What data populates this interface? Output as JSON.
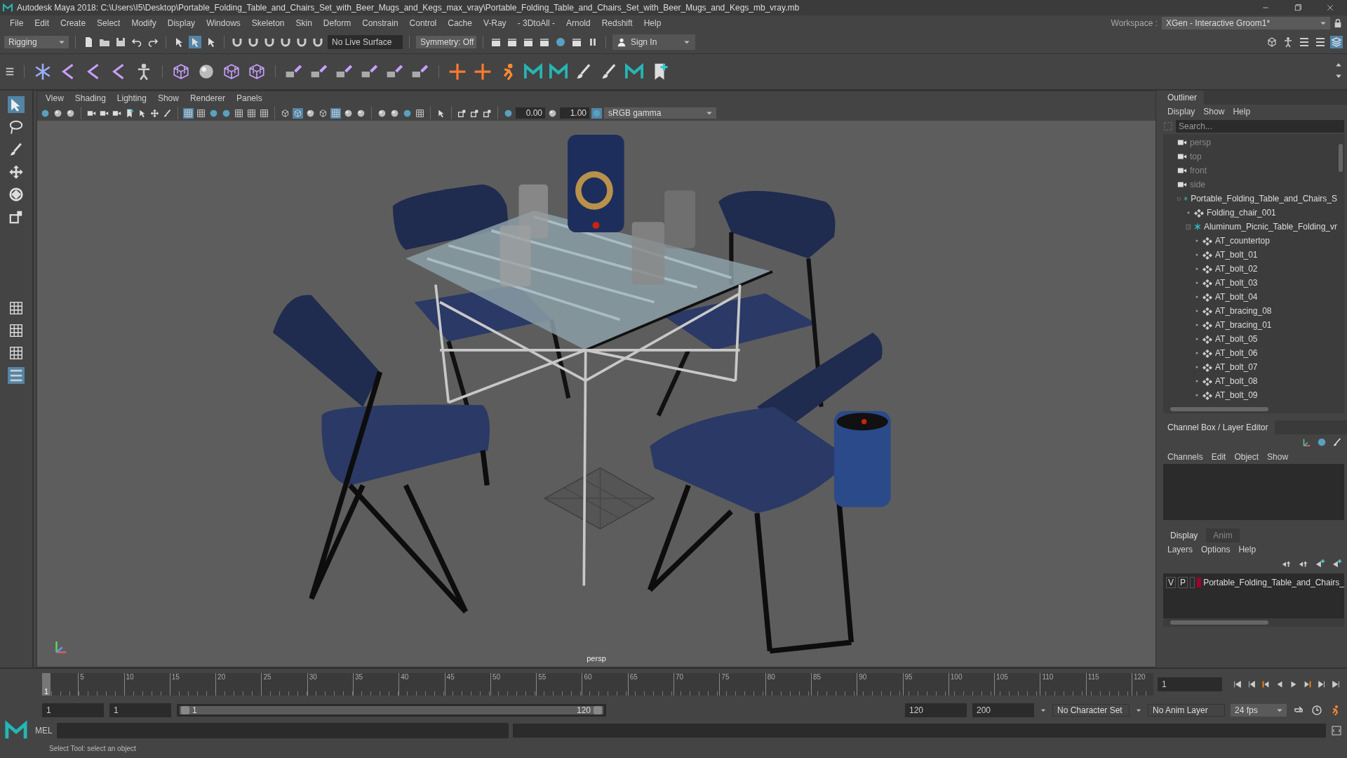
{
  "window": {
    "title": "Autodesk Maya 2018: C:\\Users\\I5\\Desktop\\Portable_Folding_Table_and_Chairs_Set_with_Beer_Mugs_and_Kegs_max_vray\\Portable_Folding_Table_and_Chairs_Set_with_Beer_Mugs_and_Kegs_mb_vray.mb"
  },
  "menu_bar": [
    "File",
    "Edit",
    "Create",
    "Select",
    "Modify",
    "Display",
    "Windows",
    "Skeleton",
    "Skin",
    "Deform",
    "Constrain",
    "Control",
    "Cache",
    "V-Ray",
    "- 3DtoAll -",
    "Arnold",
    "Redshift",
    "Help"
  ],
  "workspace": {
    "label": "Workspace :",
    "value": "XGen - Interactive Groom1*"
  },
  "status_line": {
    "menu_set": "Rigging",
    "live_surface": "No Live Surface",
    "symmetry": "Symmetry: Off",
    "sign_in": "Sign In"
  },
  "toolbox": [
    {
      "kind": "select",
      "selected": true
    },
    {
      "kind": "lasso",
      "selected": false
    },
    {
      "kind": "paint",
      "selected": false
    },
    {
      "kind": "move",
      "selected": false
    },
    {
      "kind": "rotate",
      "selected": false
    },
    {
      "kind": "scale",
      "selected": false
    }
  ],
  "viewport": {
    "menus": [
      "View",
      "Shading",
      "Lighting",
      "Show",
      "Renderer",
      "Panels"
    ],
    "exposure": "0.00",
    "gamma": "1.00",
    "color_space": "sRGB gamma",
    "camera_label": "persp"
  },
  "outliner": {
    "title": "Outliner",
    "menus": [
      "Display",
      "Show",
      "Help"
    ],
    "search_placeholder": "Search...",
    "items": [
      {
        "kind": "camera",
        "label": "persp"
      },
      {
        "kind": "camera",
        "label": "top"
      },
      {
        "kind": "camera",
        "label": "front"
      },
      {
        "kind": "camera",
        "label": "side"
      },
      {
        "kind": "group",
        "label": "Portable_Folding_Table_and_Chairs_S",
        "expanded": true,
        "children": [
          {
            "kind": "mesh",
            "label": "Folding_chair_001"
          },
          {
            "kind": "group",
            "label": "Aluminum_Picnic_Table_Folding_vr",
            "expanded": true,
            "children": [
              {
                "kind": "mesh",
                "label": "AT_countertop"
              },
              {
                "kind": "mesh",
                "label": "AT_bolt_01"
              },
              {
                "kind": "mesh",
                "label": "AT_bolt_02"
              },
              {
                "kind": "mesh",
                "label": "AT_bolt_03"
              },
              {
                "kind": "mesh",
                "label": "AT_bolt_04"
              },
              {
                "kind": "mesh",
                "label": "AT_bracing_08"
              },
              {
                "kind": "mesh",
                "label": "AT_bracing_01"
              },
              {
                "kind": "mesh",
                "label": "AT_bolt_05"
              },
              {
                "kind": "mesh",
                "label": "AT_bolt_06"
              },
              {
                "kind": "mesh",
                "label": "AT_bolt_07"
              },
              {
                "kind": "mesh",
                "label": "AT_bolt_08"
              },
              {
                "kind": "mesh",
                "label": "AT_bolt_09"
              }
            ]
          }
        ]
      }
    ]
  },
  "channel_box": {
    "title": "Channel Box / Layer Editor",
    "menus": [
      "Channels",
      "Edit",
      "Object",
      "Show"
    ]
  },
  "layer_editor": {
    "tabs": [
      {
        "label": "Display",
        "selected": true
      },
      {
        "label": "Anim",
        "selected": false
      }
    ],
    "menus": [
      "Layers",
      "Options",
      "Help"
    ],
    "layers": [
      {
        "visible": "V",
        "playback": "P",
        "color": "#a0002a",
        "name": "Portable_Folding_Table_and_Chairs_"
      }
    ]
  },
  "timeline": {
    "level": 0,
    "start_marker": "1",
    "ticks": [
      "5",
      "10",
      "15",
      "20",
      "25",
      "30",
      "35",
      "40",
      "45",
      "50",
      "55",
      "60",
      "65",
      "70",
      "75",
      "80",
      "85",
      "90",
      "95",
      "100",
      "105",
      "110",
      "115",
      "120"
    ],
    "current_frame": "1"
  },
  "range": {
    "level": 1,
    "start": "1",
    "playback_start": "1",
    "slider_start": "1",
    "slider_end": "120",
    "playback_end": "120",
    "end": "200",
    "character_set": "No Character Set",
    "anim_layer": "No Anim Layer",
    "fps": "24 fps"
  },
  "command_line": {
    "language": "MEL"
  },
  "help_line": "Select Tool: select an object"
}
